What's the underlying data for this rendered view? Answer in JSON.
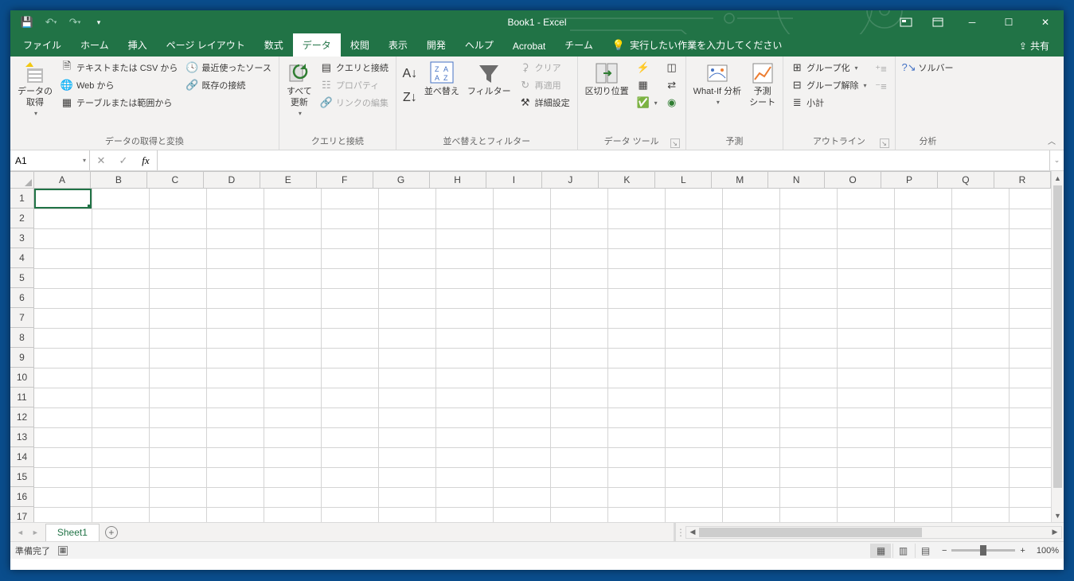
{
  "title": "Book1  -  Excel",
  "qat": {
    "save": "💾"
  },
  "winctl": {
    "profile": "◻",
    "ribbonMode": "▭"
  },
  "tabs": {
    "file": "ファイル",
    "home": "ホーム",
    "insert": "挿入",
    "pageLayout": "ページ レイアウト",
    "formulas": "数式",
    "data": "データ",
    "review": "校閲",
    "view": "表示",
    "developer": "開発",
    "help": "ヘルプ",
    "acrobat": "Acrobat",
    "team": "チーム",
    "tellme": "実行したい作業を入力してください",
    "share": "共有"
  },
  "ribbon": {
    "getData": {
      "btn": "データの\n取得",
      "textCsv": "テキストまたは CSV から",
      "web": "Web から",
      "table": "テーブルまたは範囲から",
      "recent": "最近使ったソース",
      "existing": "既存の接続",
      "group": "データの取得と変換"
    },
    "refresh": {
      "btn": "すべて\n更新",
      "qconn": "クエリと接続",
      "prop": "プロパティ",
      "link": "リンクの編集",
      "group": "クエリと接続"
    },
    "sort": {
      "sort": "並べ替え",
      "filter": "フィルター",
      "clear": "クリア",
      "reapply": "再適用",
      "advanced": "詳細設定",
      "group": "並べ替えとフィルター"
    },
    "tools": {
      "textToCol": "区切り位置",
      "group": "データ ツール"
    },
    "forecast": {
      "whatif": "What-If 分析",
      "forecast": "予測\nシート",
      "group": "予測"
    },
    "outline": {
      "groupBtn": "グループ化",
      "ungroup": "グループ解除",
      "subtotal": "小計",
      "group": "アウトライン"
    },
    "analysis": {
      "solver": "ソルバー",
      "group": "分析"
    }
  },
  "namebox": "A1",
  "columns": [
    "A",
    "B",
    "C",
    "D",
    "E",
    "F",
    "G",
    "H",
    "I",
    "J",
    "K",
    "L",
    "M",
    "N",
    "O",
    "P",
    "Q",
    "R"
  ],
  "rows": [
    "1",
    "2",
    "3",
    "4",
    "5",
    "6",
    "7",
    "8",
    "9",
    "10",
    "11",
    "12",
    "13",
    "14",
    "15",
    "16",
    "17"
  ],
  "sheetTab": "Sheet1",
  "status": {
    "ready": "準備完了",
    "zoom": "100%"
  }
}
